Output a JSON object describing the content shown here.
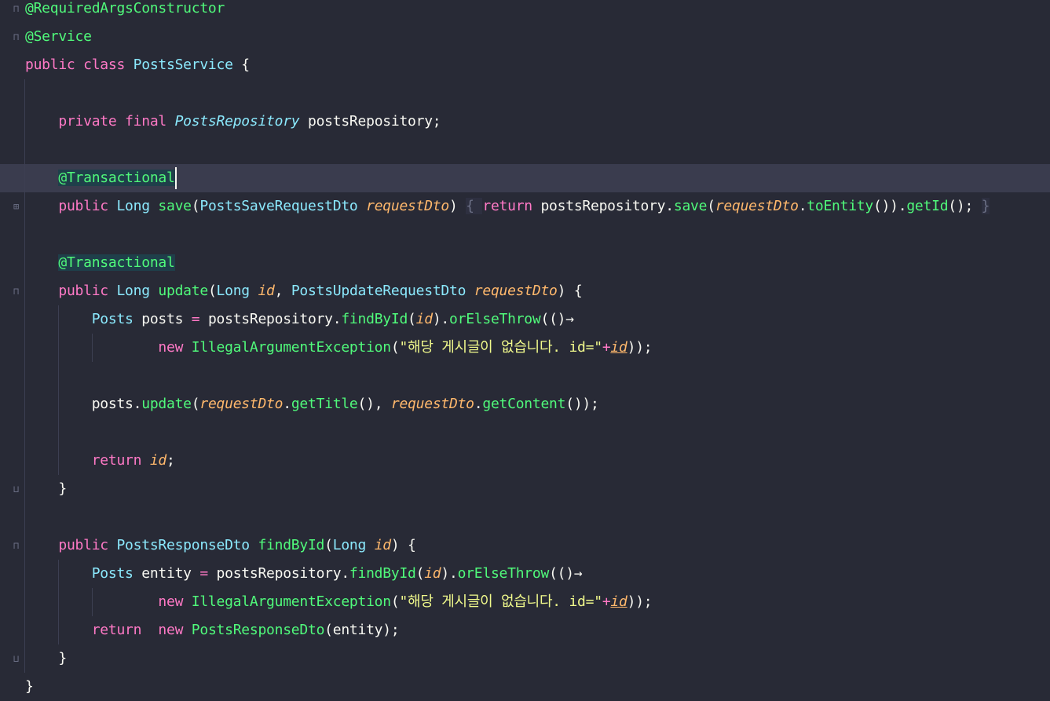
{
  "editor": {
    "lines": [
      {
        "tokens": [
          {
            "t": "@RequiredArgsConstructor",
            "c": "ann"
          }
        ]
      },
      {
        "tokens": [
          {
            "t": "@Service",
            "c": "ann"
          }
        ]
      },
      {
        "tokens": [
          {
            "t": "public ",
            "c": "kw"
          },
          {
            "t": "class ",
            "c": "kw"
          },
          {
            "t": "PostsService",
            "c": "type"
          },
          {
            "t": " {",
            "c": "plain"
          }
        ]
      },
      {
        "tokens": []
      },
      {
        "tokens": [
          {
            "t": "    ",
            "c": "plain"
          },
          {
            "t": "private ",
            "c": "kw"
          },
          {
            "t": "final ",
            "c": "kw"
          },
          {
            "t": "PostsRepository",
            "c": "ifc"
          },
          {
            "t": " postsRepository;",
            "c": "plain"
          }
        ]
      },
      {
        "tokens": []
      },
      {
        "tokens": [
          {
            "t": "    ",
            "c": "plain"
          },
          {
            "t": "@Transactional",
            "c": "ann-hl"
          }
        ]
      },
      {
        "tokens": [
          {
            "t": "    ",
            "c": "plain"
          },
          {
            "t": "public ",
            "c": "kw"
          },
          {
            "t": "Long ",
            "c": "type"
          },
          {
            "t": "save",
            "c": "fn"
          },
          {
            "t": "(",
            "c": "plain"
          },
          {
            "t": "PostsSaveRequestDto ",
            "c": "type"
          },
          {
            "t": "requestDto",
            "c": "param"
          },
          {
            "t": ") ",
            "c": "plain"
          },
          {
            "t": "{ ",
            "c": "brace-box"
          },
          {
            "t": "return ",
            "c": "kw"
          },
          {
            "t": "postsRepository.",
            "c": "plain"
          },
          {
            "t": "save",
            "c": "fn"
          },
          {
            "t": "(",
            "c": "plain"
          },
          {
            "t": "requestDto",
            "c": "param"
          },
          {
            "t": ".",
            "c": "plain"
          },
          {
            "t": "toEntity",
            "c": "fn"
          },
          {
            "t": "()).",
            "c": "plain"
          },
          {
            "t": "getId",
            "c": "fn"
          },
          {
            "t": "(); ",
            "c": "plain"
          },
          {
            "t": "}",
            "c": "brace-box"
          }
        ]
      },
      {
        "tokens": []
      },
      {
        "tokens": [
          {
            "t": "    ",
            "c": "plain"
          },
          {
            "t": "@Transactional",
            "c": "ann-hl"
          }
        ]
      },
      {
        "tokens": [
          {
            "t": "    ",
            "c": "plain"
          },
          {
            "t": "public ",
            "c": "kw"
          },
          {
            "t": "Long ",
            "c": "type"
          },
          {
            "t": "update",
            "c": "fn"
          },
          {
            "t": "(",
            "c": "plain"
          },
          {
            "t": "Long ",
            "c": "type"
          },
          {
            "t": "id",
            "c": "param"
          },
          {
            "t": ", ",
            "c": "plain"
          },
          {
            "t": "PostsUpdateRequestDto ",
            "c": "type"
          },
          {
            "t": "requestDto",
            "c": "param"
          },
          {
            "t": ") {",
            "c": "plain"
          }
        ]
      },
      {
        "tokens": [
          {
            "t": "        ",
            "c": "plain"
          },
          {
            "t": "Posts ",
            "c": "type"
          },
          {
            "t": "posts ",
            "c": "plain"
          },
          {
            "t": "= ",
            "c": "op"
          },
          {
            "t": "postsRepository.",
            "c": "plain"
          },
          {
            "t": "findById",
            "c": "fn"
          },
          {
            "t": "(",
            "c": "plain"
          },
          {
            "t": "id",
            "c": "param"
          },
          {
            "t": ").",
            "c": "plain"
          },
          {
            "t": "orElseThrow",
            "c": "fn"
          },
          {
            "t": "(()→",
            "c": "plain"
          }
        ]
      },
      {
        "tokens": [
          {
            "t": "                ",
            "c": "plain"
          },
          {
            "t": "new ",
            "c": "kw"
          },
          {
            "t": "IllegalArgumentException",
            "c": "fn"
          },
          {
            "t": "(",
            "c": "plain"
          },
          {
            "t": "\"해당 게시글이 없습니다. id=\"",
            "c": "str"
          },
          {
            "t": "+",
            "c": "op"
          },
          {
            "t": "id",
            "c": "param-u"
          },
          {
            "t": "));",
            "c": "plain"
          }
        ]
      },
      {
        "tokens": []
      },
      {
        "tokens": [
          {
            "t": "        ",
            "c": "plain"
          },
          {
            "t": "posts.",
            "c": "plain"
          },
          {
            "t": "update",
            "c": "fn"
          },
          {
            "t": "(",
            "c": "plain"
          },
          {
            "t": "requestDto",
            "c": "param"
          },
          {
            "t": ".",
            "c": "plain"
          },
          {
            "t": "getTitle",
            "c": "fn"
          },
          {
            "t": "(), ",
            "c": "plain"
          },
          {
            "t": "requestDto",
            "c": "param"
          },
          {
            "t": ".",
            "c": "plain"
          },
          {
            "t": "getContent",
            "c": "fn"
          },
          {
            "t": "());",
            "c": "plain"
          }
        ]
      },
      {
        "tokens": []
      },
      {
        "tokens": [
          {
            "t": "        ",
            "c": "plain"
          },
          {
            "t": "return ",
            "c": "kw"
          },
          {
            "t": "id",
            "c": "param"
          },
          {
            "t": ";",
            "c": "plain"
          }
        ]
      },
      {
        "tokens": [
          {
            "t": "    ",
            "c": "plain"
          },
          {
            "t": "}",
            "c": "plain"
          }
        ]
      },
      {
        "tokens": []
      },
      {
        "tokens": [
          {
            "t": "    ",
            "c": "plain"
          },
          {
            "t": "public ",
            "c": "kw"
          },
          {
            "t": "PostsResponseDto ",
            "c": "type"
          },
          {
            "t": "findById",
            "c": "fn"
          },
          {
            "t": "(",
            "c": "plain"
          },
          {
            "t": "Long ",
            "c": "type"
          },
          {
            "t": "id",
            "c": "param"
          },
          {
            "t": ") {",
            "c": "plain"
          }
        ]
      },
      {
        "tokens": [
          {
            "t": "        ",
            "c": "plain"
          },
          {
            "t": "Posts ",
            "c": "type"
          },
          {
            "t": "entity ",
            "c": "plain"
          },
          {
            "t": "= ",
            "c": "op"
          },
          {
            "t": "postsRepository.",
            "c": "plain"
          },
          {
            "t": "findById",
            "c": "fn"
          },
          {
            "t": "(",
            "c": "plain"
          },
          {
            "t": "id",
            "c": "param"
          },
          {
            "t": ").",
            "c": "plain"
          },
          {
            "t": "orElseThrow",
            "c": "fn"
          },
          {
            "t": "(()→",
            "c": "plain"
          }
        ]
      },
      {
        "tokens": [
          {
            "t": "                ",
            "c": "plain"
          },
          {
            "t": "new ",
            "c": "kw"
          },
          {
            "t": "IllegalArgumentException",
            "c": "fn"
          },
          {
            "t": "(",
            "c": "plain"
          },
          {
            "t": "\"해당 게시글이 없습니다. id=\"",
            "c": "str"
          },
          {
            "t": "+",
            "c": "op"
          },
          {
            "t": "id",
            "c": "param-u"
          },
          {
            "t": "));",
            "c": "plain"
          }
        ]
      },
      {
        "tokens": [
          {
            "t": "        ",
            "c": "plain"
          },
          {
            "t": "return  ",
            "c": "kw"
          },
          {
            "t": "new ",
            "c": "kw"
          },
          {
            "t": "PostsResponseDto",
            "c": "fn"
          },
          {
            "t": "(entity);",
            "c": "plain"
          }
        ]
      },
      {
        "tokens": [
          {
            "t": "    ",
            "c": "plain"
          },
          {
            "t": "}",
            "c": "plain"
          }
        ]
      },
      {
        "tokens": [
          {
            "t": "}",
            "c": "plain"
          }
        ]
      }
    ],
    "current_line": 6,
    "fold_markers": [
      {
        "line": 0,
        "icon": "fold-start-icon"
      },
      {
        "line": 1,
        "icon": "fold-start-icon"
      },
      {
        "line": 7,
        "icon": "fold-collapsed-icon"
      },
      {
        "line": 10,
        "icon": "fold-start-icon"
      },
      {
        "line": 17,
        "icon": "fold-end-icon"
      },
      {
        "line": 19,
        "icon": "fold-start-icon"
      },
      {
        "line": 23,
        "icon": "fold-end-icon"
      }
    ],
    "colors": {
      "background": "#282a36",
      "current_line": "#3a3c4e",
      "annotation": "#50fa7b",
      "keyword": "#ff79c6",
      "type": "#8be9fd",
      "function": "#50fa7b",
      "parameter": "#ffb86c",
      "string": "#f1fa8c",
      "text": "#f8f8f2"
    }
  }
}
